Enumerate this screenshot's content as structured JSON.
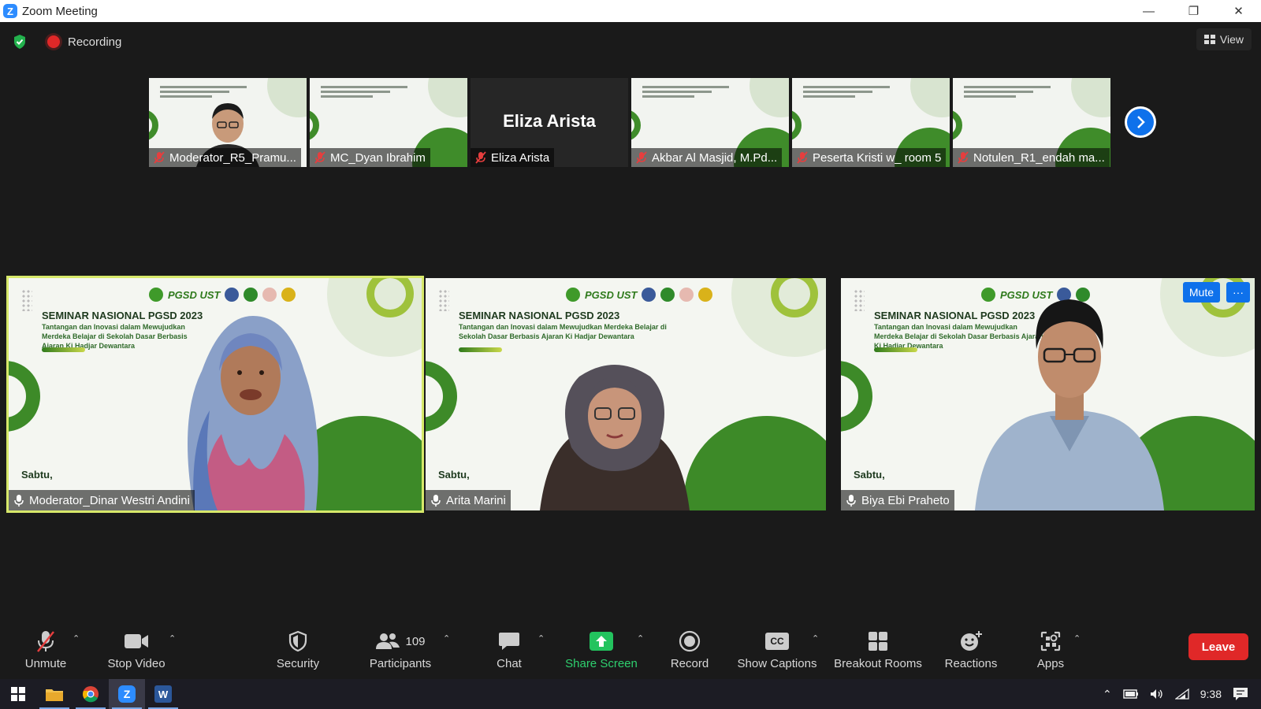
{
  "window": {
    "title": "Zoom Meeting",
    "icon": "zoom-logo-icon"
  },
  "header": {
    "recording_label": "Recording",
    "view_label": "View"
  },
  "thumbnails": [
    {
      "name": "Moderator_R5_Pramu...",
      "type": "video-person"
    },
    {
      "name": "MC_Dyan Ibrahim",
      "type": "video-slide"
    },
    {
      "name": "Eliza Arista",
      "big_name": "Eliza Arista",
      "type": "name-only"
    },
    {
      "name": "Akbar Al Masjid, M.Pd...",
      "type": "video-slide"
    },
    {
      "name": "Peserta Kristi w_ room 5",
      "type": "video-slide"
    },
    {
      "name": "Notulen_R1_endah ma...",
      "type": "video-slide"
    }
  ],
  "slide": {
    "brand": "PGSD UST",
    "title": "SEMINAR NASIONAL PGSD 2023",
    "subtitle": "Tantangan dan Inovasi dalam Mewujudkan Merdeka Belajar di Sekolah Dasar Berbasis Ajaran Ki Hadjar Dewantara",
    "date": "Sabtu,"
  },
  "speakers": [
    {
      "name": "Moderator_Dinar Westri Andini",
      "active": true
    },
    {
      "name": "Arita Marini",
      "active": false
    },
    {
      "name": "Biya Ebi Praheto",
      "active": false
    }
  ],
  "speaker_controls": {
    "mute_label": "Mute",
    "more_label": "···"
  },
  "toolbar": {
    "unmute": "Unmute",
    "stop_video": "Stop Video",
    "security": "Security",
    "participants": "Participants",
    "participants_count": "109",
    "chat": "Chat",
    "share_screen": "Share Screen",
    "record": "Record",
    "show_captions": "Show Captions",
    "captions_badge": "CC",
    "breakout_rooms": "Breakout Rooms",
    "reactions": "Reactions",
    "apps": "Apps",
    "leave": "Leave"
  },
  "taskbar": {
    "time": "9:38"
  },
  "colors": {
    "accent_blue": "#0e71eb",
    "leave_red": "#e02828",
    "share_green": "#2ed06e",
    "active_outline": "#d7e86a",
    "slide_green": "#3d8a28"
  }
}
